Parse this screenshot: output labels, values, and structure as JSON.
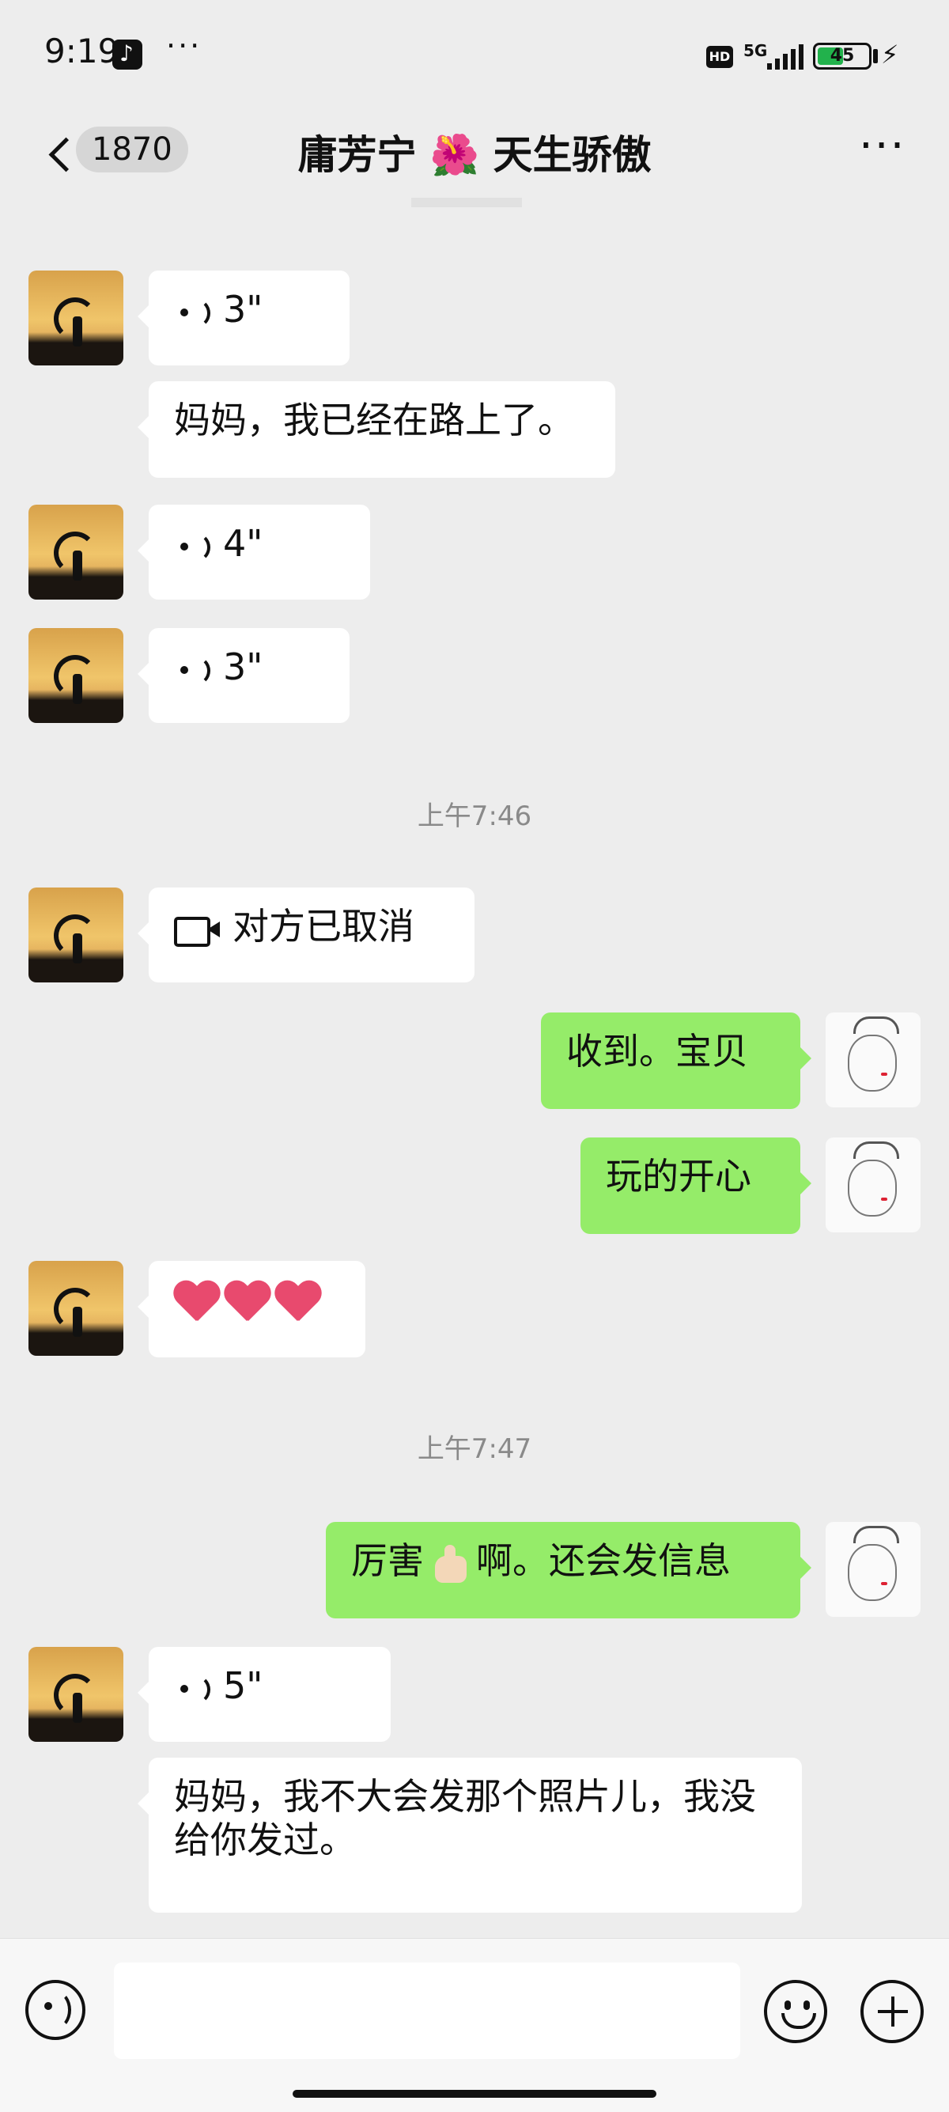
{
  "status_bar": {
    "time": "9:19",
    "network": "5G",
    "battery": "45",
    "icons": [
      "tiktok-icon",
      "more-dots-icon",
      "hd-icon",
      "signal-icon",
      "battery-icon",
      "charging-icon"
    ]
  },
  "header": {
    "back_badge": "1870",
    "title": "庸芳宁 🌺 天生骄傲",
    "more_label": "···"
  },
  "messages": {
    "m1": {
      "duration": "3\""
    },
    "m2": {
      "text": "妈妈，我已经在路上了。"
    },
    "m3": {
      "duration": "4\""
    },
    "m4": {
      "duration": "3\""
    },
    "time1": "上午7:46",
    "m5": {
      "text": "对方已取消"
    },
    "m6": {
      "text": "收到。宝贝"
    },
    "m7": {
      "text": "玩的开心"
    },
    "time2": "上午7:47",
    "m9a": "厉害",
    "m9b": "啊。还会发信息",
    "m10": {
      "duration": "5\""
    },
    "m11": {
      "text": "妈妈，我不大会发那个照片儿，我没给你发过。"
    }
  },
  "input": {
    "placeholder": ""
  },
  "colors": {
    "background": "#ededed",
    "sent_bubble": "#95ec69",
    "received_bubble": "#ffffff",
    "heart": "#e84a6e"
  }
}
